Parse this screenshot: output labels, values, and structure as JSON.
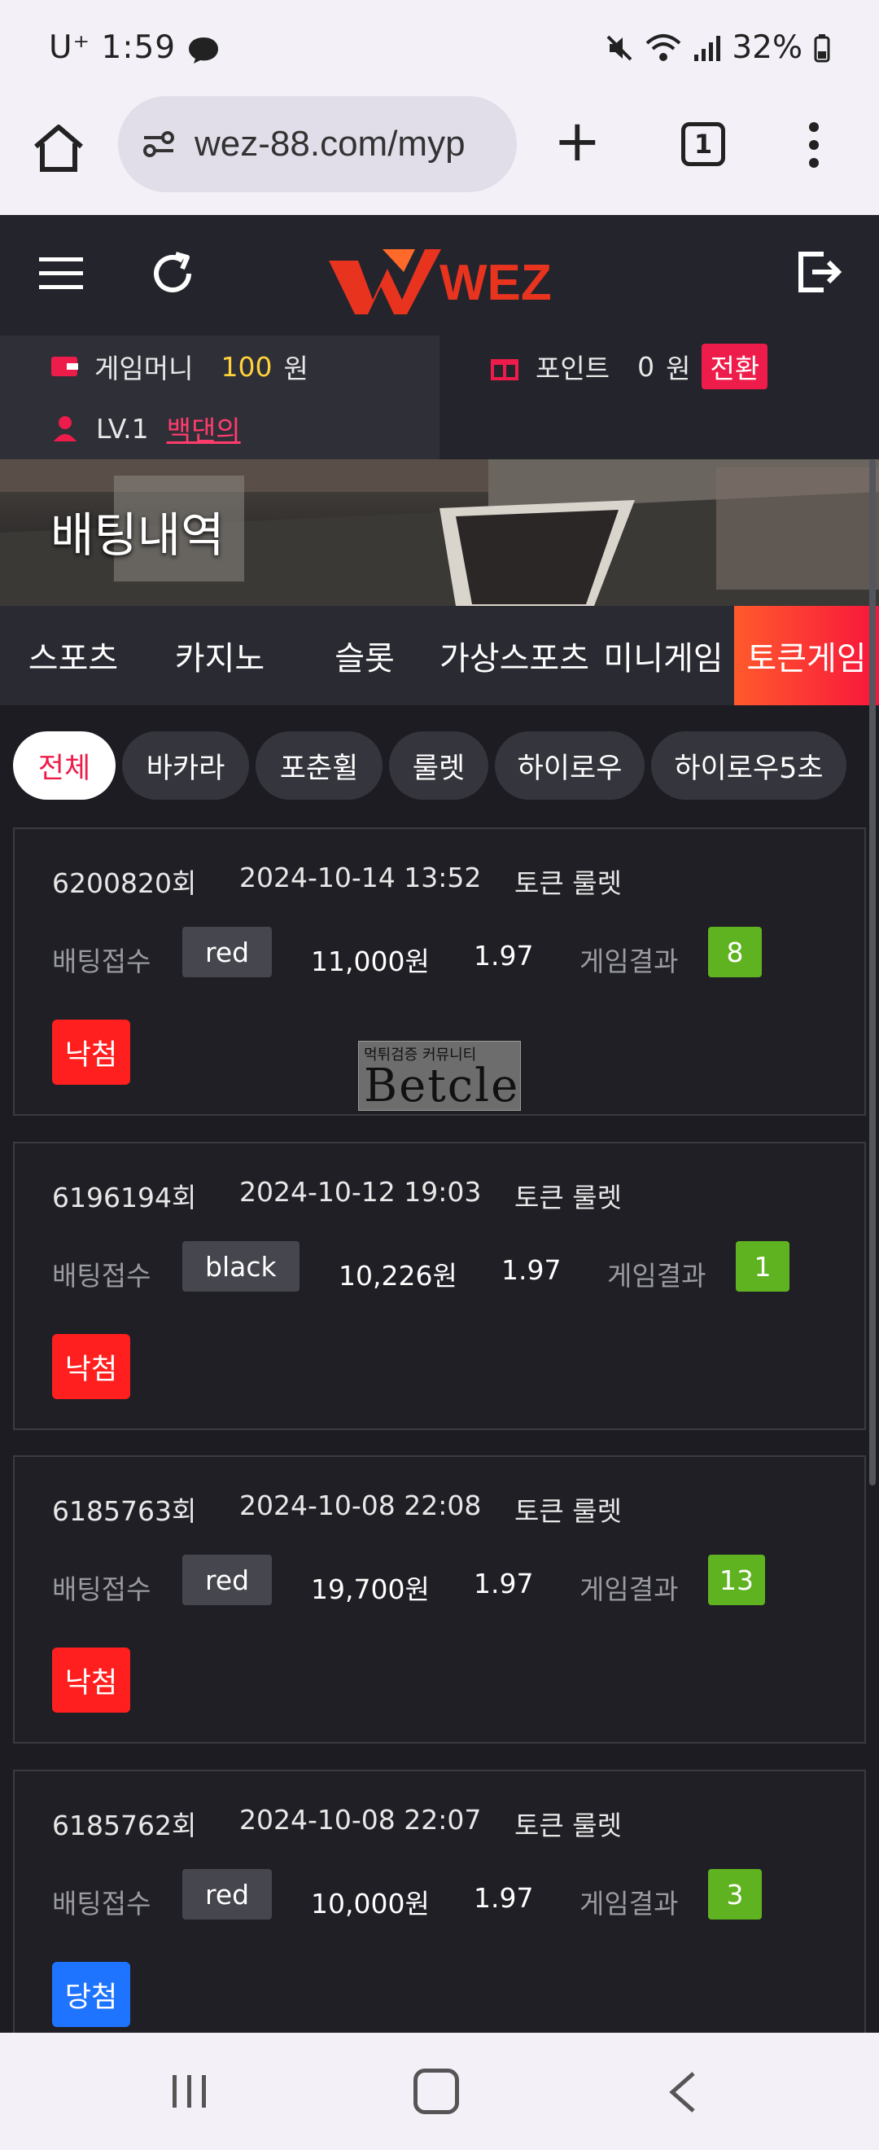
{
  "status_bar": {
    "carrier_time": "U⁺ 1:59",
    "battery": "32%"
  },
  "browser": {
    "url": "wez-88.com/myp",
    "tab_count": "1"
  },
  "header": {
    "logo_text": "WEZ"
  },
  "account": {
    "money_label": "게임머니",
    "money_value": "100",
    "money_unit": "원",
    "point_label": "포인트",
    "point_value": "0",
    "point_unit": "원",
    "convert_label": "전환",
    "level": "LV.1",
    "username": "백댄의"
  },
  "banner": {
    "title": "배팅내역"
  },
  "category_tabs": [
    {
      "label": "스포츠"
    },
    {
      "label": "카지노"
    },
    {
      "label": "슬롯"
    },
    {
      "label": "가상스포츠"
    },
    {
      "label": "미니게임"
    },
    {
      "label": "토큰게임"
    }
  ],
  "sub_tabs": [
    {
      "label": "전체"
    },
    {
      "label": "바카라"
    },
    {
      "label": "포춘휠"
    },
    {
      "label": "룰렛"
    },
    {
      "label": "하이로우"
    },
    {
      "label": "하이로우5초"
    }
  ],
  "bets": [
    {
      "round": "6200820회",
      "datetime": "2024-10-14 13:52",
      "game": "토큰 룰렛",
      "bet_label": "배팅접수",
      "pick": "red",
      "amount": "11,000원",
      "odds": "1.97",
      "result_label": "게임결과",
      "result": "8",
      "status": "낙첨"
    },
    {
      "round": "6196194회",
      "datetime": "2024-10-12 19:03",
      "game": "토큰 룰렛",
      "bet_label": "배팅접수",
      "pick": "black",
      "amount": "10,226원",
      "odds": "1.97",
      "result_label": "게임결과",
      "result": "1",
      "status": "낙첨"
    },
    {
      "round": "6185763회",
      "datetime": "2024-10-08 22:08",
      "game": "토큰 룰렛",
      "bet_label": "배팅접수",
      "pick": "red",
      "amount": "19,700원",
      "odds": "1.97",
      "result_label": "게임결과",
      "result": "13",
      "status": "낙첨"
    },
    {
      "round": "6185762회",
      "datetime": "2024-10-08 22:07",
      "game": "토큰 룰렛",
      "bet_label": "배팅접수",
      "pick": "red",
      "amount": "10,000원",
      "odds": "1.97",
      "result_label": "게임결과",
      "result": "3",
      "status": "당첨"
    }
  ],
  "watermark": {
    "top_text": "먹튀검증 커뮤니티",
    "main_text": "Betcle"
  },
  "colors": {
    "accent": "#ee1c4a",
    "result_green": "#5fb320",
    "lose_red": "#ff1f1f",
    "win_blue": "#1f74ff"
  }
}
